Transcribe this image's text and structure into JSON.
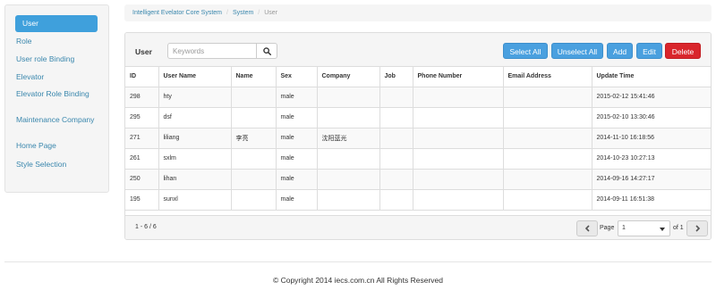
{
  "sidebar": {
    "items": [
      {
        "label": "User"
      },
      {
        "label": "Role"
      },
      {
        "label": "User role Binding"
      },
      {
        "label": "Elevator"
      },
      {
        "label": "Elevator Role Binding"
      },
      {
        "label": "Maintenance Company"
      },
      {
        "label": "Home Page"
      },
      {
        "label": "Style Selection"
      }
    ]
  },
  "breadcrumb": {
    "root": "Intelligent Evelator Core System",
    "section": "System",
    "current": "User"
  },
  "toolbar": {
    "label": "User",
    "search_placeholder": "Keywords",
    "select_all": "Select All",
    "unselect_all": "Unselect All",
    "add": "Add",
    "edit": "Edit",
    "delete": "Delete"
  },
  "table": {
    "headers": [
      "ID",
      "User Name",
      "Name",
      "Sex",
      "Company",
      "Job",
      "Phone Number",
      "Email Address",
      "Update Time"
    ],
    "rows": [
      [
        "298",
        "hty",
        "",
        "male",
        "",
        "",
        "",
        "",
        "2015-02-12 15:41:46"
      ],
      [
        "295",
        "dsf",
        "",
        "male",
        "",
        "",
        "",
        "",
        "2015-02-10 13:30:46"
      ],
      [
        "271",
        "liliang",
        "李亮",
        "male",
        "沈阳蓝光",
        "",
        "",
        "",
        "2014-11-10 16:18:56"
      ],
      [
        "261",
        "sxlm",
        "",
        "male",
        "",
        "",
        "",
        "",
        "2014-10-23 10:27:13"
      ],
      [
        "250",
        "lihan",
        "",
        "male",
        "",
        "",
        "",
        "",
        "2014-09-16 14:27:17"
      ],
      [
        "195",
        "sunxl",
        "",
        "male",
        "",
        "",
        "",
        "",
        "2014-09-11 16:51:38"
      ]
    ]
  },
  "pagination": {
    "range": "1 - 6 / 6",
    "page_label": "Page",
    "page_value": "1",
    "of_label": "of 1"
  },
  "footer": {
    "copyright": "© Copyright 2014 iecs.com.cn All Rights Reserved"
  },
  "colors": {
    "primary": "#4aa0df",
    "danger": "#d9262c",
    "link": "#3a87ad"
  },
  "icons": {
    "search": "search-icon",
    "prev": "chevron-left-icon",
    "next": "chevron-right-icon",
    "dropdown": "caret-down-icon"
  }
}
